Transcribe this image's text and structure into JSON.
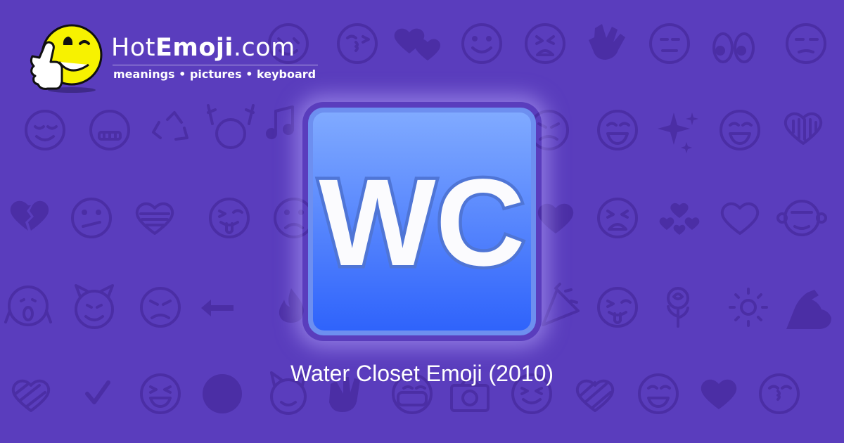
{
  "site": {
    "name_prefix": "Hot",
    "name_bold": "Emoji",
    "name_suffix": ".com",
    "tagline": "meanings • pictures • keyboard"
  },
  "emoji": {
    "glyph_text": "WC",
    "caption": "Water Closet Emoji (2010)",
    "colors": {
      "tile_top": "#80aaff",
      "tile_bottom": "#2f63fb",
      "letter_fill": "#fbfbfe",
      "letter_stroke": "#4f75d6"
    }
  },
  "theme": {
    "background": "#5a3dbd",
    "pattern_color": "#4b2ea5"
  },
  "background_icons": [
    "heart-eyes-face-icon",
    "kissing-wink-face-icon",
    "two-hearts-icon",
    "smiling-face-icon",
    "weary-face-icon",
    "ok-hand-icon",
    "expressionless-face-icon",
    "eyes-icon",
    "unamused-face-icon",
    "relieved-face-icon",
    "grimacing-face-icon",
    "recycle-icon",
    "raising-hands-icon",
    "music-notes-icon",
    "angry-face-icon",
    "grinning-face-icon",
    "sparkles-icon",
    "striped-heart-icon",
    "broken-heart-icon",
    "confused-face-icon",
    "tongue-wink-face-icon",
    "frowning-face-icon",
    "heart-arrow-icon",
    "tired-face-icon",
    "revolving-hearts-icon",
    "heart-icon",
    "see-no-evil-monkey-icon",
    "screaming-face-icon",
    "smiling-imp-icon",
    "angry-face-icon",
    "left-arrow-icon",
    "fire-icon",
    "confetti-icon",
    "rose-icon",
    "sun-icon",
    "flexed-biceps-icon",
    "check-mark-icon",
    "laughing-face-icon",
    "full-moon-face-icon",
    "heart-eyes-cat-icon",
    "waving-hand-icon",
    "medical-mask-face-icon",
    "camera-icon",
    "beaming-face-icon",
    "kissing-face-icon"
  ]
}
